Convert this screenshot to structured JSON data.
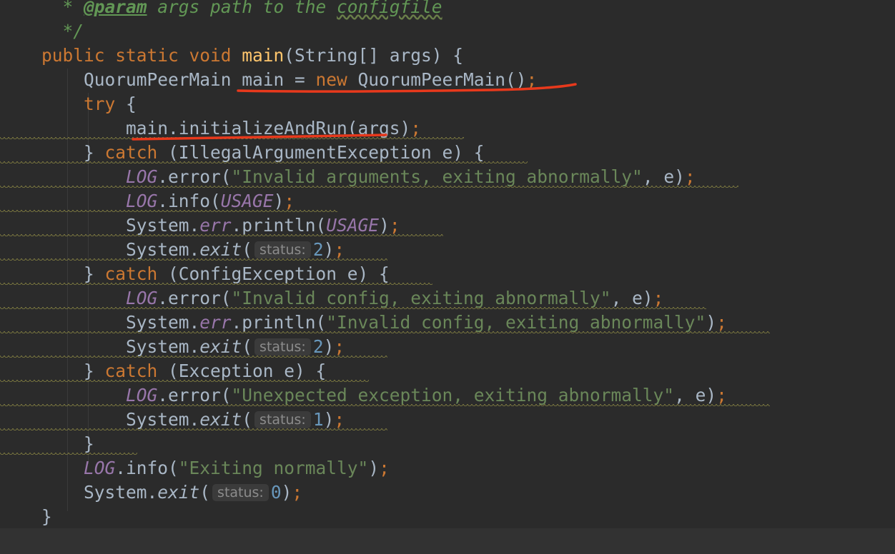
{
  "editor": {
    "lines": [
      [
        {
          "t": "  * ",
          "c": "comment"
        },
        {
          "t": "@param",
          "c": "doctag"
        },
        {
          "t": " args path to the ",
          "c": "comment"
        },
        {
          "t": "configfile",
          "c": "docref"
        }
      ],
      [
        {
          "t": "  */",
          "c": "comment"
        }
      ],
      [
        {
          "t": "public static void ",
          "c": "keyword"
        },
        {
          "t": "main",
          "c": "method"
        },
        {
          "t": "(String[] args) {",
          "c": "plain"
        }
      ],
      [
        {
          "t": "    QuorumPeerMain main = ",
          "c": "plain"
        },
        {
          "t": "new ",
          "c": "keyword"
        },
        {
          "t": "QuorumPeerMain()",
          "c": "plain"
        },
        {
          "t": ";",
          "c": "semi"
        }
      ],
      [
        {
          "t": "    ",
          "c": "plain"
        },
        {
          "t": "try",
          "c": "keyword"
        },
        {
          "t": " {",
          "c": "plain"
        }
      ],
      [
        {
          "t": "        main.initializeAndRun(args)",
          "c": "plain"
        },
        {
          "t": ";",
          "c": "semi"
        }
      ],
      [
        {
          "t": "    } ",
          "c": "plain"
        },
        {
          "t": "catch ",
          "c": "keyword"
        },
        {
          "t": "(IllegalArgumentException e) {",
          "c": "plain"
        }
      ],
      [
        {
          "t": "        ",
          "c": "plain"
        },
        {
          "t": "LOG",
          "c": "field"
        },
        {
          "t": ".error(",
          "c": "plain"
        },
        {
          "t": "\"Invalid arguments, exiting abnormally\"",
          "c": "string"
        },
        {
          "t": ", e)",
          "c": "plain"
        },
        {
          "t": ";",
          "c": "semi"
        }
      ],
      [
        {
          "t": "        ",
          "c": "plain"
        },
        {
          "t": "LOG",
          "c": "field"
        },
        {
          "t": ".info(",
          "c": "plain"
        },
        {
          "t": "USAGE",
          "c": "field"
        },
        {
          "t": ")",
          "c": "plain"
        },
        {
          "t": ";",
          "c": "semi"
        }
      ],
      [
        {
          "t": "        System.",
          "c": "plain"
        },
        {
          "t": "err",
          "c": "field"
        },
        {
          "t": ".println(",
          "c": "plain"
        },
        {
          "t": "USAGE",
          "c": "field"
        },
        {
          "t": ")",
          "c": "plain"
        },
        {
          "t": ";",
          "c": "semi"
        }
      ],
      [
        {
          "t": "        System.",
          "c": "plain"
        },
        {
          "t": "exit",
          "c": "static"
        },
        {
          "t": "(",
          "c": "plain"
        },
        {
          "t": "status:",
          "c": "hint"
        },
        {
          "t": "2",
          "c": "number"
        },
        {
          "t": ")",
          "c": "plain"
        },
        {
          "t": ";",
          "c": "semi"
        }
      ],
      [
        {
          "t": "    } ",
          "c": "plain"
        },
        {
          "t": "catch ",
          "c": "keyword"
        },
        {
          "t": "(ConfigException e) {",
          "c": "plain"
        }
      ],
      [
        {
          "t": "        ",
          "c": "plain"
        },
        {
          "t": "LOG",
          "c": "field"
        },
        {
          "t": ".error(",
          "c": "plain"
        },
        {
          "t": "\"Invalid config, exiting abnormally\"",
          "c": "string"
        },
        {
          "t": ", e)",
          "c": "plain"
        },
        {
          "t": ";",
          "c": "semi"
        }
      ],
      [
        {
          "t": "        System.",
          "c": "plain"
        },
        {
          "t": "err",
          "c": "field"
        },
        {
          "t": ".println(",
          "c": "plain"
        },
        {
          "t": "\"Invalid config, exiting abnormally\"",
          "c": "string"
        },
        {
          "t": ")",
          "c": "plain"
        },
        {
          "t": ";",
          "c": "semi"
        }
      ],
      [
        {
          "t": "        System.",
          "c": "plain"
        },
        {
          "t": "exit",
          "c": "static"
        },
        {
          "t": "(",
          "c": "plain"
        },
        {
          "t": "status:",
          "c": "hint"
        },
        {
          "t": "2",
          "c": "number"
        },
        {
          "t": ")",
          "c": "plain"
        },
        {
          "t": ";",
          "c": "semi"
        }
      ],
      [
        {
          "t": "    } ",
          "c": "plain"
        },
        {
          "t": "catch ",
          "c": "keyword"
        },
        {
          "t": "(Exception e) {",
          "c": "plain"
        }
      ],
      [
        {
          "t": "        ",
          "c": "plain"
        },
        {
          "t": "LOG",
          "c": "field"
        },
        {
          "t": ".error(",
          "c": "plain"
        },
        {
          "t": "\"Unexpected exception, exiting abnormally\"",
          "c": "string"
        },
        {
          "t": ", e)",
          "c": "plain"
        },
        {
          "t": ";",
          "c": "semi"
        }
      ],
      [
        {
          "t": "        System.",
          "c": "plain"
        },
        {
          "t": "exit",
          "c": "static"
        },
        {
          "t": "(",
          "c": "plain"
        },
        {
          "t": "status:",
          "c": "hint"
        },
        {
          "t": "1",
          "c": "number"
        },
        {
          "t": ")",
          "c": "plain"
        },
        {
          "t": ";",
          "c": "semi"
        }
      ],
      [
        {
          "t": "    }",
          "c": "plain"
        }
      ],
      [
        {
          "t": "    ",
          "c": "plain"
        },
        {
          "t": "LOG",
          "c": "field"
        },
        {
          "t": ".info(",
          "c": "plain"
        },
        {
          "t": "\"Exiting normally\"",
          "c": "string"
        },
        {
          "t": ")",
          "c": "plain"
        },
        {
          "t": ";",
          "c": "semi"
        }
      ],
      [
        {
          "t": "    System.",
          "c": "plain"
        },
        {
          "t": "exit",
          "c": "static"
        },
        {
          "t": "(",
          "c": "plain"
        },
        {
          "t": "status:",
          "c": "hint"
        },
        {
          "t": "0",
          "c": "number"
        },
        {
          "t": ")",
          "c": "plain"
        },
        {
          "t": ";",
          "c": "semi"
        }
      ],
      [
        {
          "t": "}",
          "c": "plain"
        }
      ]
    ]
  },
  "colors": {
    "background": "#2b2b2b",
    "keyword": "#cc7832",
    "method": "#ffc66d",
    "field": "#9876aa",
    "string": "#6a8759",
    "number": "#6897bb",
    "plain": "#a9b7c6",
    "comment": "#629755",
    "annotation_ink": "#e8391c"
  }
}
